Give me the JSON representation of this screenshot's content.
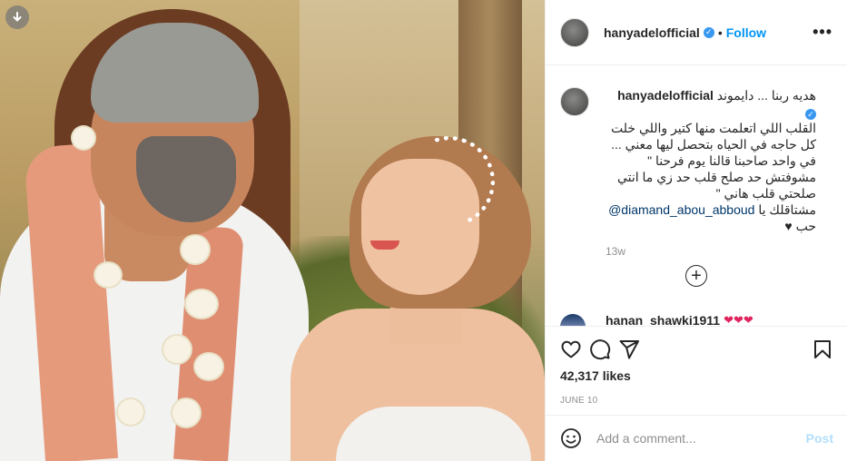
{
  "post": {
    "username": "hanyadelofficial",
    "follow_label": "Follow",
    "separator": "•",
    "more_label": "•••"
  },
  "caption": {
    "username": "hanyadelofficial",
    "lines": [
      "هديه ربنا ... دايموند",
      "القلب اللي اتعلمت منها كتير واللي خلت",
      "كل حاجه في الحياه بتحصل ليها معني ...",
      "في واحد صاحبنا قالنا يوم فرحنا \"",
      "مشوفتش حد صلح قلب حد زي ما انتي",
      "صلحتي قلب هاني \""
    ],
    "mention_prefix": "مشتاقلك يا",
    "mention": "@diamand_abou_abboud",
    "last_line": "حب ♥",
    "time_ago": "13w"
  },
  "load_more_label": "+",
  "comment2": {
    "username": "hanan_shawki1911",
    "hearts": "❤❤❤"
  },
  "likes": "42,317 likes",
  "date": "JUNE 10",
  "add_comment": {
    "placeholder": "Add a comment...",
    "post_label": "Post"
  },
  "colors": {
    "link_blue": "#0095f6",
    "verified_blue": "#3897f0",
    "post_disabled": "#b2dffc",
    "muted": "#8e8e8e"
  },
  "icons": [
    "download-icon",
    "verified-icon",
    "more-icon",
    "heart-icon",
    "comment-icon",
    "share-icon",
    "bookmark-icon",
    "emoji-icon",
    "plus-circle-icon"
  ]
}
